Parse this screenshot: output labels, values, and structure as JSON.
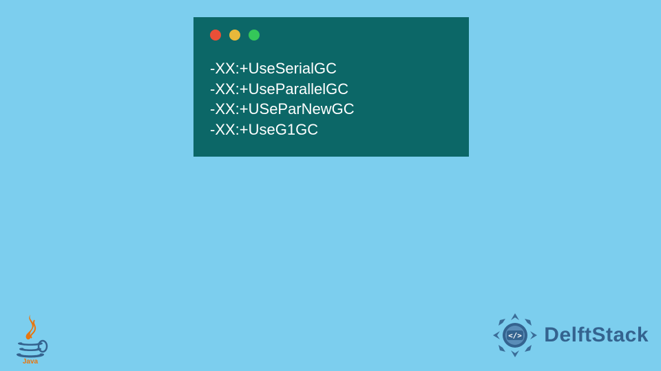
{
  "window": {
    "dots": {
      "red": "#e94f37",
      "yellow": "#e8b83a",
      "green": "#34c759"
    },
    "bg": "#0c6767"
  },
  "code": {
    "line1": "-XX:+UseSerialGC",
    "line2": "-XX:+UseParallelGC",
    "line3": "-XX:+USeParNewGC",
    "line4": "-XX:+UseG1GC"
  },
  "logos": {
    "java_label": "Java",
    "delftstack_label": "DelftStack"
  }
}
